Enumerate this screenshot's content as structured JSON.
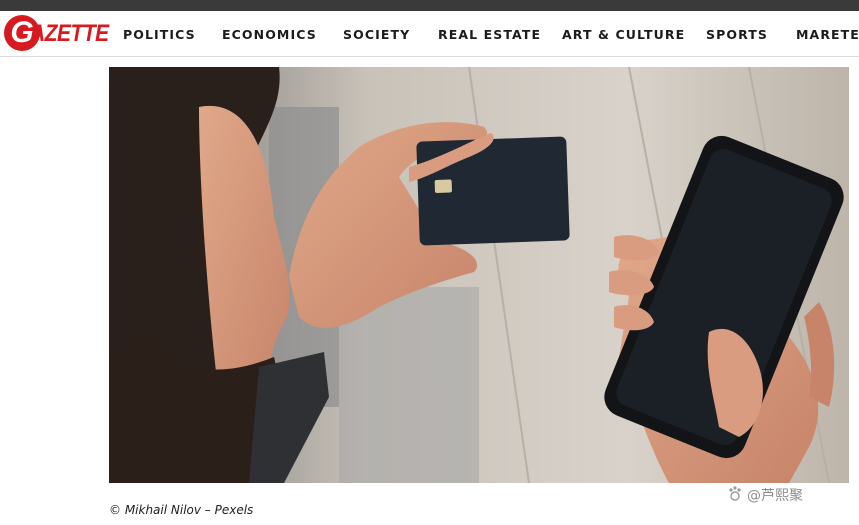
{
  "brand": {
    "logo_text": "GAZETTE",
    "logo_color": "#d71920"
  },
  "nav": {
    "items": [
      {
        "label": "POLITICS"
      },
      {
        "label": "ECONOMICS"
      },
      {
        "label": "SOCIETY"
      },
      {
        "label": "REAL ESTATE"
      },
      {
        "label": "ART & CULTURE"
      },
      {
        "label": "SPORTS"
      },
      {
        "label": "MARETER"
      }
    ]
  },
  "article": {
    "image_alt": "Man holding a bank card and a smartphone",
    "caption": "© Mikhail Nilov – Pexels"
  },
  "watermark": {
    "icon": "paw-icon",
    "text": "@芦熙聚"
  }
}
